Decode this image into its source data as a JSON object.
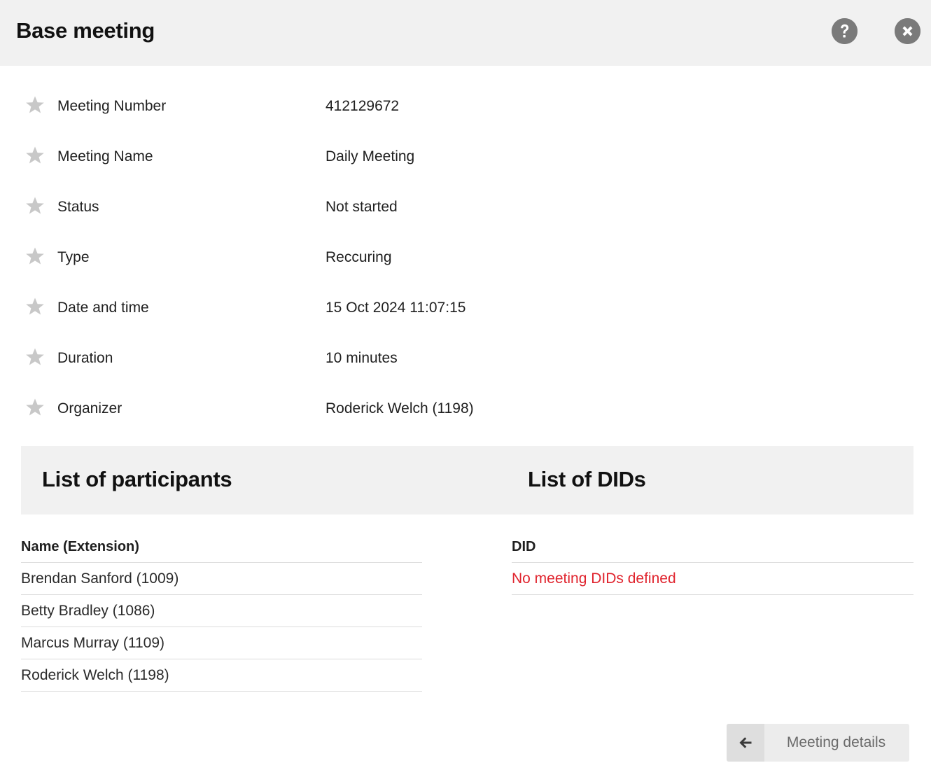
{
  "header": {
    "title": "Base meeting",
    "help_icon": "question-circle-icon",
    "close_icon": "close-circle-icon"
  },
  "details": [
    {
      "label": "Meeting Number",
      "value": "412129672"
    },
    {
      "label": "Meeting Name",
      "value": "Daily Meeting"
    },
    {
      "label": "Status",
      "value": "Not started"
    },
    {
      "label": "Type",
      "value": "Reccuring"
    },
    {
      "label": "Date and time",
      "value": "15 Oct 2024 11:07:15"
    },
    {
      "label": "Duration",
      "value": "10 minutes"
    },
    {
      "label": "Organizer",
      "value": "Roderick Welch (1198)"
    }
  ],
  "sections": {
    "participants_title": "List of participants",
    "dids_title": "List of DIDs"
  },
  "participants": {
    "header": "Name (Extension)",
    "rows": [
      "Brendan Sanford (1009)",
      "Betty Bradley (1086)",
      "Marcus Murray (1109)",
      "Roderick Welch (1198)"
    ]
  },
  "dids": {
    "header": "DID",
    "empty_message": "No meeting DIDs defined"
  },
  "footer": {
    "back_label": "Meeting details",
    "back_icon": "arrow-left-icon"
  },
  "colors": {
    "header_bg": "#f1f1f1",
    "error_text": "#e0242e",
    "icon_grey": "#7a7a7a",
    "star_grey": "#c8c8c8"
  }
}
